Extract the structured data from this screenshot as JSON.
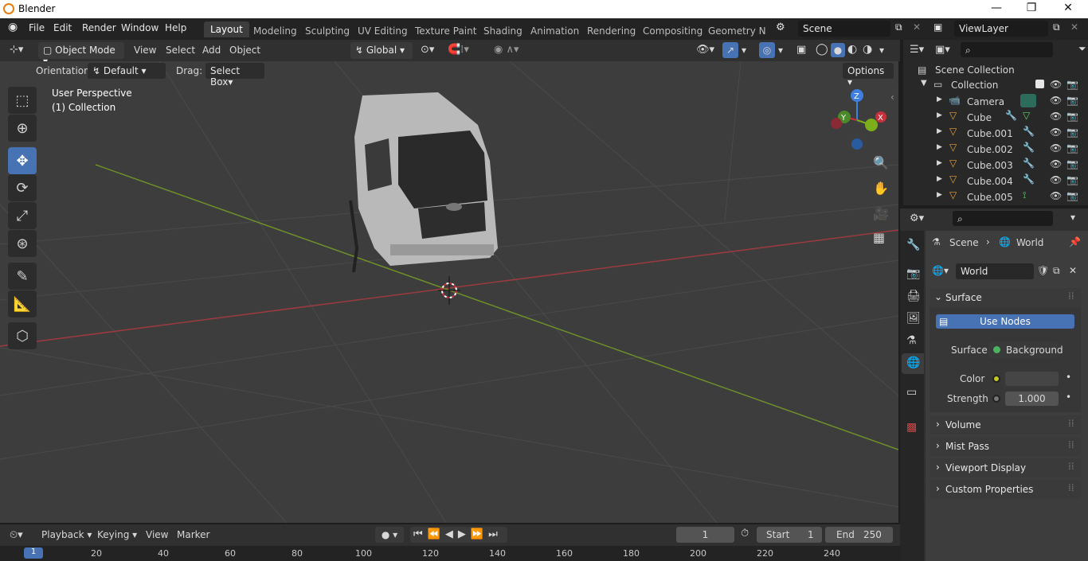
{
  "window": {
    "title": "Blender",
    "controls": [
      "—",
      "❐",
      "✕"
    ]
  },
  "menu": [
    "File",
    "Edit",
    "Render",
    "Window",
    "Help"
  ],
  "workspaces": [
    "Layout",
    "Modeling",
    "Sculpting",
    "UV Editing",
    "Texture Paint",
    "Shading",
    "Animation",
    "Rendering",
    "Compositing",
    "Geometry Noc"
  ],
  "scene": {
    "name": "Scene",
    "view_layer": "ViewLayer"
  },
  "viewport_header": {
    "mode": "Object Mode",
    "menus": [
      "View",
      "Select",
      "Add",
      "Object"
    ],
    "transform": "Global",
    "orientation_label": "Orientation:",
    "orientation_value": "Default",
    "drag_label": "Drag:",
    "drag_value": "Select Box",
    "options": "Options"
  },
  "viewport": {
    "perspective": "User Perspective",
    "collection": "(1) Collection",
    "gizmo": {
      "z": "Z",
      "y": "Y",
      "x": "X"
    }
  },
  "colors": {
    "accent": "#4772b3",
    "x_axis": "#c8303a",
    "y_axis": "#7cae1b",
    "z_axis": "#3f7fe0",
    "orange": "#e8a13a"
  },
  "outliner": {
    "root": "Scene Collection",
    "collection": "Collection",
    "items": [
      {
        "name": "Camera",
        "icon": "camera-icon"
      },
      {
        "name": "Cube",
        "icon": "mesh-icon"
      },
      {
        "name": "Cube.001",
        "icon": "mesh-icon"
      },
      {
        "name": "Cube.002",
        "icon": "mesh-icon"
      },
      {
        "name": "Cube.003",
        "icon": "mesh-icon"
      },
      {
        "name": "Cube.004",
        "icon": "mesh-icon"
      },
      {
        "name": "Cube.005",
        "icon": "mesh-icon"
      }
    ]
  },
  "properties": {
    "breadcrumb": {
      "scene": "Scene",
      "world": "World"
    },
    "world_name": "World",
    "surface_panel": "Surface",
    "use_nodes": "Use Nodes",
    "surface_label": "Surface",
    "surface_value": "Background",
    "color_label": "Color",
    "strength_label": "Strength",
    "strength_value": "1.000",
    "panels": [
      "Volume",
      "Mist Pass",
      "Viewport Display",
      "Custom Properties"
    ]
  },
  "timeline": {
    "menus": [
      "Playback",
      "Keying",
      "View",
      "Marker"
    ],
    "current_frame": "1",
    "start_label": "Start",
    "start": "1",
    "end_label": "End",
    "end": "250",
    "ticks": [
      "20",
      "40",
      "60",
      "80",
      "100",
      "120",
      "140",
      "160",
      "180",
      "200",
      "220",
      "240"
    ],
    "current_tick": "1"
  }
}
